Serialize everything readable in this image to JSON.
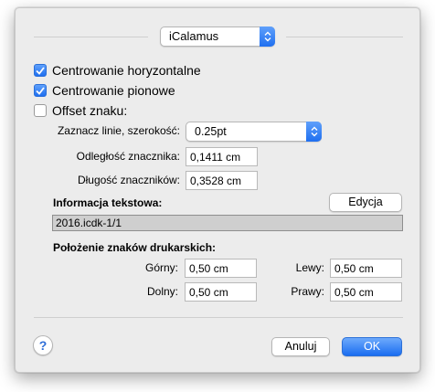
{
  "top_popup": {
    "value": "iCalamus"
  },
  "checkboxes": [
    {
      "label": "Centrowanie horyzontalne",
      "checked": true
    },
    {
      "label": "Centrowanie pionowe",
      "checked": true
    },
    {
      "label": "Offset znaku:",
      "checked": false
    }
  ],
  "line_width": {
    "label": "Zaznacz linie, szerokość:",
    "value": "0.25pt"
  },
  "marker_distance": {
    "label": "Odległość znacznika:",
    "value": "0,1411 cm"
  },
  "marker_length": {
    "label": "Długość znaczników:",
    "value": "0,3528 cm"
  },
  "text_info": {
    "heading": "Informacja tekstowa:",
    "edit_button": "Edycja",
    "value": "2016.icdk-1/1"
  },
  "print_marks": {
    "heading": "Położenie znaków drukarskich:",
    "top": {
      "label": "Górny:",
      "value": "0,50 cm"
    },
    "left": {
      "label": "Lewy:",
      "value": "0,50 cm"
    },
    "bottom": {
      "label": "Dolny:",
      "value": "0,50 cm"
    },
    "right": {
      "label": "Prawy:",
      "value": "0,50 cm"
    }
  },
  "footer": {
    "help": "?",
    "cancel": "Anuluj",
    "ok": "OK"
  },
  "colors": {
    "accent": "#1f6ff0",
    "dialog_bg": "#ececec"
  }
}
